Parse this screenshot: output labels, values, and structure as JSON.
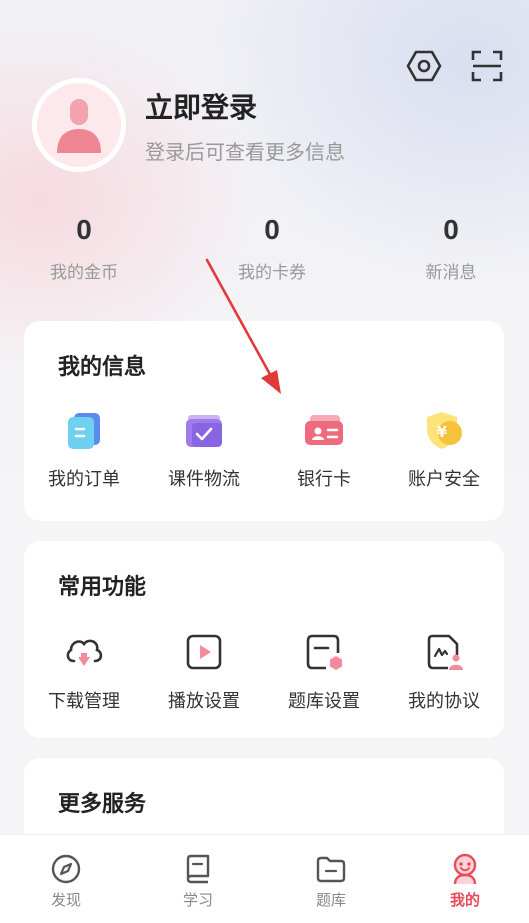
{
  "header": {
    "title": "立即登录",
    "subtitle": "登录后可查看更多信息"
  },
  "stats": [
    {
      "value": "0",
      "label": "我的金币"
    },
    {
      "value": "0",
      "label": "我的卡券"
    },
    {
      "value": "0",
      "label": "新消息"
    }
  ],
  "my_info": {
    "title": "我的信息",
    "items": [
      {
        "label": "我的订单",
        "icon": "order-icon"
      },
      {
        "label": "课件物流",
        "icon": "logistics-icon"
      },
      {
        "label": "银行卡",
        "icon": "bank-card-icon"
      },
      {
        "label": "账户安全",
        "icon": "account-security-icon"
      }
    ]
  },
  "common": {
    "title": "常用功能",
    "items": [
      {
        "label": "下载管理",
        "icon": "download-icon"
      },
      {
        "label": "播放设置",
        "icon": "play-settings-icon"
      },
      {
        "label": "题库设置",
        "icon": "question-bank-settings-icon"
      },
      {
        "label": "我的协议",
        "icon": "agreement-icon"
      }
    ]
  },
  "more": {
    "title": "更多服务"
  },
  "tabbar": [
    {
      "label": "发现",
      "icon": "compass-icon"
    },
    {
      "label": "学习",
      "icon": "book-icon"
    },
    {
      "label": "题库",
      "icon": "folder-icon"
    },
    {
      "label": "我的",
      "icon": "smiley-icon",
      "active": true
    }
  ],
  "colors": {
    "accent": "#e94b5b",
    "annotation_arrow": "#e03a3a"
  }
}
